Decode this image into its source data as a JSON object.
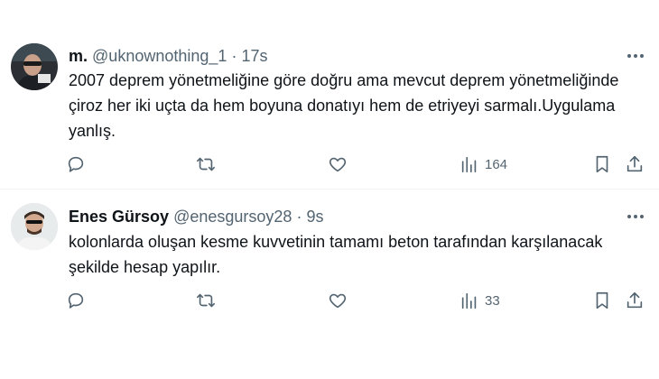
{
  "tweets": [
    {
      "name": "m.",
      "handle": "@uknownothing_1",
      "separator": "·",
      "time": "17s",
      "text": "2007 deprem yönetmeliğine göre doğru ama mevcut deprem yönetmeliğinde çiroz her iki uçta da hem boyuna donatıyı hem de etriyeyi sarmalı.Uygulama yanlış.",
      "views": "164",
      "avatar_icon": "user-photo"
    },
    {
      "name": "Enes Gürsoy",
      "handle": "@enesgursoy28",
      "separator": "·",
      "time": "9s",
      "text": "kolonlarda oluşan  kesme kuvvetinin tamamı beton tarafından karşılanacak şekilde hesap yapılır.",
      "views": "33",
      "avatar_icon": "user-photo"
    }
  ],
  "icons": {
    "reply": "reply-icon",
    "retweet": "retweet-icon",
    "like": "heart-icon",
    "views": "views-bar-chart-icon",
    "bookmark": "bookmark-icon",
    "share": "share-icon",
    "more": "more-dots-icon"
  },
  "colors": {
    "text_primary": "#0f1419",
    "text_secondary": "#536471",
    "divider": "#eff3f4",
    "background": "#ffffff"
  }
}
